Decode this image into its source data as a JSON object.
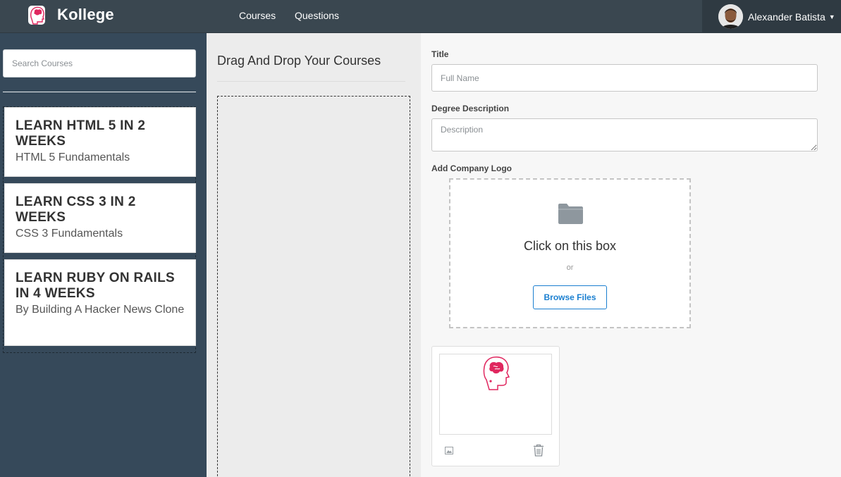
{
  "app": {
    "name": "Kollege"
  },
  "nav": {
    "courses": "Courses",
    "questions": "Questions"
  },
  "user": {
    "name": "Alexander Batista"
  },
  "sidebar": {
    "search_placeholder": "Search Courses",
    "courses": [
      {
        "title": "LEARN HTML 5 IN 2 WEEKS",
        "subtitle": "HTML 5 Fundamentals"
      },
      {
        "title": "LEARN CSS 3 IN 2 WEEKS",
        "subtitle": "CSS 3 Fundamentals"
      },
      {
        "title": "LEARN RUBY ON RAILS IN 4 WEEKS",
        "subtitle": "By Building A Hacker News Clone"
      }
    ]
  },
  "middle": {
    "title": "Drag And Drop Your Courses"
  },
  "form": {
    "title_label": "Title",
    "title_placeholder": "Full Name",
    "description_label": "Degree Description",
    "description_placeholder": "Description",
    "logo_label": "Add Company Logo",
    "upload_text": "Click on this box",
    "or_text": "or",
    "browse_label": "Browse Files"
  },
  "colors": {
    "topbar": "#3a4750",
    "sidebar": "#36495a",
    "accent": "#1a7fd0",
    "logo_pink": "#e0275f"
  }
}
